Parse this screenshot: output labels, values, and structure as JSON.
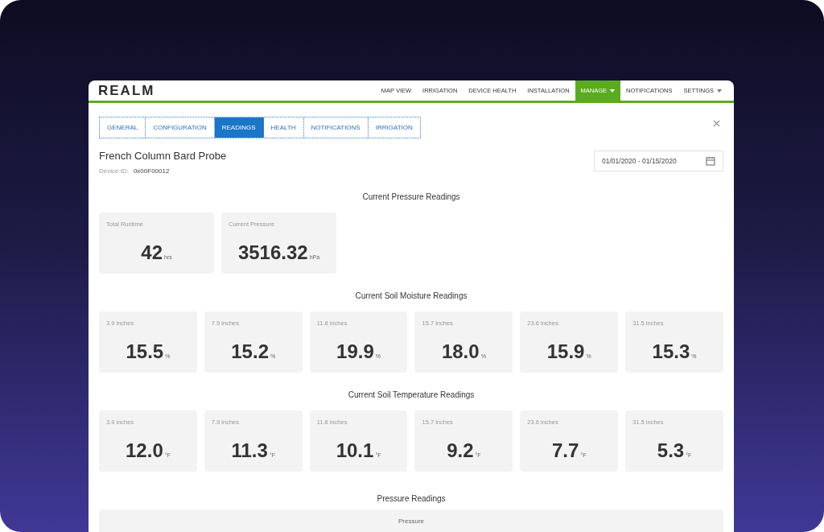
{
  "logo": "REALM",
  "nav": [
    {
      "label": "MAP VIEW",
      "selected": false,
      "dropdown": false
    },
    {
      "label": "IRRIGATION",
      "selected": false,
      "dropdown": false
    },
    {
      "label": "DEVICE HEALTH",
      "selected": false,
      "dropdown": false
    },
    {
      "label": "INSTALLATION",
      "selected": false,
      "dropdown": false
    },
    {
      "label": "MANAGE",
      "selected": true,
      "dropdown": true
    },
    {
      "label": "NOTIFICATIONS",
      "selected": false,
      "dropdown": false
    },
    {
      "label": "SETTINGS",
      "selected": false,
      "dropdown": true
    }
  ],
  "tabs": [
    {
      "label": "GENERAL",
      "selected": false
    },
    {
      "label": "CONFIGURATION",
      "selected": false
    },
    {
      "label": "READINGS",
      "selected": true
    },
    {
      "label": "HEALTH",
      "selected": false
    },
    {
      "label": "NOTIFICATIONS",
      "selected": false
    },
    {
      "label": "IRRIGATION",
      "selected": false
    }
  ],
  "device": {
    "name": "French Column Bard Probe",
    "id_label": "Device ID:",
    "id": "0x00F00012"
  },
  "date_range": {
    "value": "01/01/2020 - 01/15/2020"
  },
  "sections": [
    {
      "title": "Current Pressure Readings",
      "cards": [
        {
          "label": "Total Runtime",
          "value": "42",
          "unit": "hrs"
        },
        {
          "label": "Current Pressure",
          "value": "3516.32",
          "unit": "hPa"
        }
      ]
    },
    {
      "title": "Current Soil Moisture Readings",
      "cards": [
        {
          "label": "3.9 inches",
          "value": "15.5",
          "unit": "%"
        },
        {
          "label": "7.9 inches",
          "value": "15.2",
          "unit": "%"
        },
        {
          "label": "11.8 inches",
          "value": "19.9",
          "unit": "%"
        },
        {
          "label": "15.7 inches",
          "value": "18.0",
          "unit": "%"
        },
        {
          "label": "23.6 inches",
          "value": "15.9",
          "unit": "%"
        },
        {
          "label": "31.5 inches",
          "value": "15.3",
          "unit": "%"
        }
      ]
    },
    {
      "title": "Current Soil Temperature Readings",
      "cards": [
        {
          "label": "3.9 inches",
          "value": "12.0",
          "unit": "°F"
        },
        {
          "label": "7.9 inches",
          "value": "11.3",
          "unit": "°F"
        },
        {
          "label": "11.8 inches",
          "value": "10.1",
          "unit": "°F"
        },
        {
          "label": "15.7 inches",
          "value": "9.2",
          "unit": "°F"
        },
        {
          "label": "23.6 inches",
          "value": "7.7",
          "unit": "°F"
        },
        {
          "label": "31.5 inches",
          "value": "5.3",
          "unit": "°F"
        }
      ]
    }
  ],
  "pressure_chart": {
    "title": "Pressure Readings",
    "label": "Pressure"
  }
}
